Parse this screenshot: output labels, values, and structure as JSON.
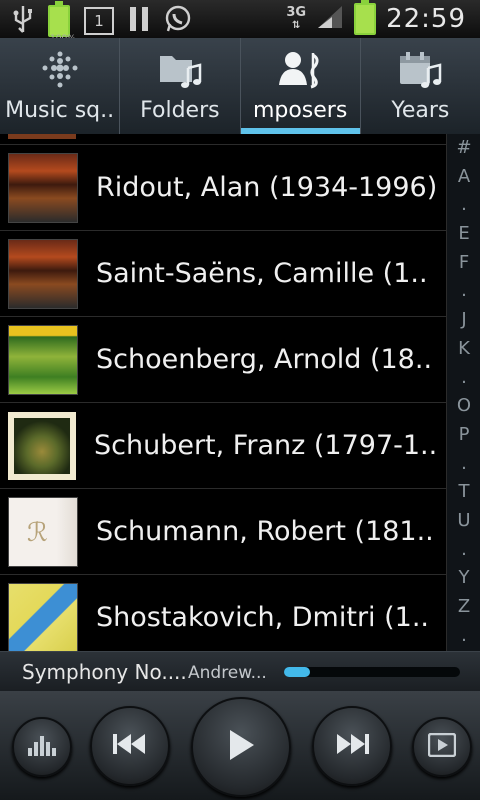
{
  "status_bar": {
    "battery_pct": "100%",
    "sim_label": "1",
    "network": "3G",
    "clock": "22:59"
  },
  "tabs": [
    {
      "label": "Music sq..",
      "icon": "music-square-icon",
      "active": false
    },
    {
      "label": "Folders",
      "icon": "folder-music-icon",
      "active": false
    },
    {
      "label": "mposers",
      "icon": "composer-icon",
      "active": true
    },
    {
      "label": "Years",
      "icon": "calendar-music-icon",
      "active": false
    }
  ],
  "composers": [
    {
      "name": "Ridout, Alan (1934-1996)"
    },
    {
      "name": "Saint-Saëns, Camille (1.."
    },
    {
      "name": "Schoenberg, Arnold (18.."
    },
    {
      "name": "Schubert, Franz (1797-1.."
    },
    {
      "name": "Schumann, Robert (181.."
    },
    {
      "name": "Shostakovich, Dmitri (1.."
    }
  ],
  "index_letters": [
    "#",
    "A",
    ".",
    "E",
    "F",
    ".",
    "J",
    "K",
    ".",
    "O",
    "P",
    ".",
    "T",
    "U",
    ".",
    "Y",
    "Z",
    "."
  ],
  "now_playing": {
    "title": "Symphony No....",
    "artist": "Andrew...",
    "progress": 0.15
  },
  "colors": {
    "accent": "#5fc2ea",
    "progress": "#43b9ea",
    "battery": "#8ad23c"
  }
}
